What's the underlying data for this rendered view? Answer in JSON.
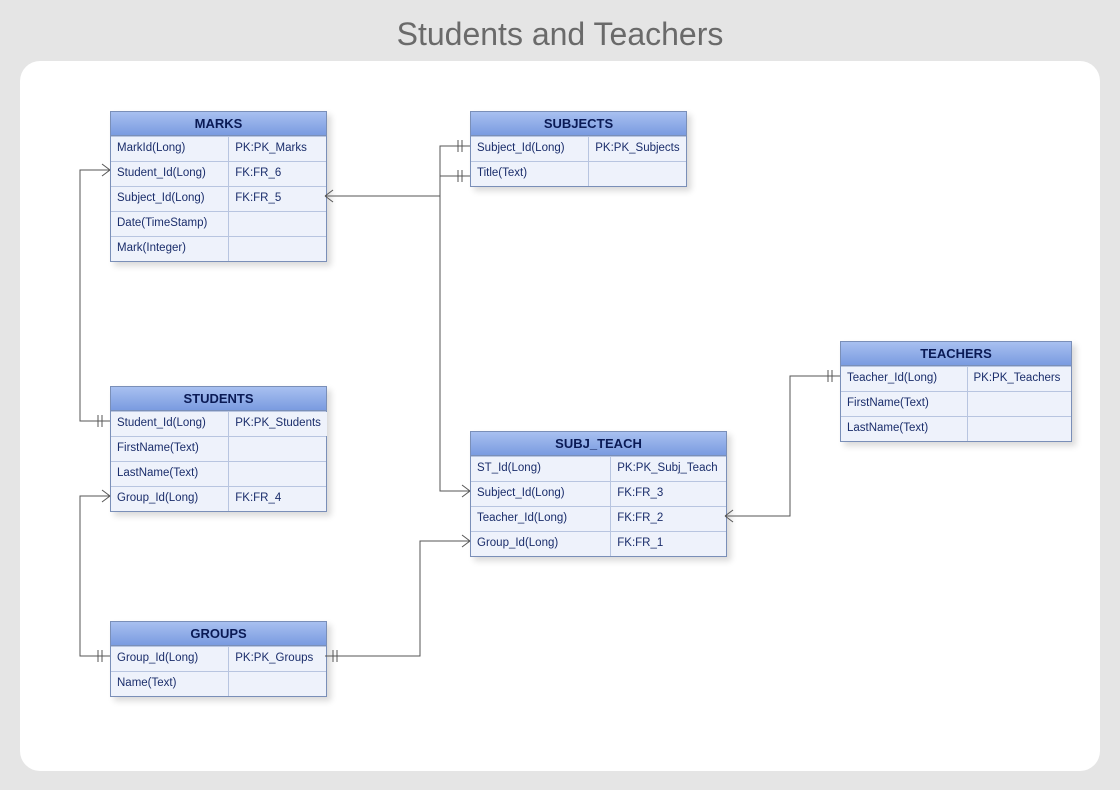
{
  "title": "Students and Teachers",
  "entities": {
    "marks": {
      "name": "MARKS",
      "rows": [
        {
          "col": "MarkId(Long)",
          "key": "PK:PK_Marks"
        },
        {
          "col": "Student_Id(Long)",
          "key": "FK:FR_6"
        },
        {
          "col": "Subject_Id(Long)",
          "key": "FK:FR_5"
        },
        {
          "col": "Date(TimeStamp)",
          "key": ""
        },
        {
          "col": "Mark(Integer)",
          "key": ""
        }
      ]
    },
    "subjects": {
      "name": "SUBJECTS",
      "rows": [
        {
          "col": "Subject_Id(Long)",
          "key": "PK:PK_Subjects"
        },
        {
          "col": "Title(Text)",
          "key": ""
        }
      ]
    },
    "students": {
      "name": "STUDENTS",
      "rows": [
        {
          "col": "Student_Id(Long)",
          "key": "PK:PK_Students"
        },
        {
          "col": "FirstName(Text)",
          "key": ""
        },
        {
          "col": "LastName(Text)",
          "key": ""
        },
        {
          "col": "Group_Id(Long)",
          "key": "FK:FR_4"
        }
      ]
    },
    "subj_teach": {
      "name": "SUBJ_TEACH",
      "rows": [
        {
          "col": "ST_Id(Long)",
          "key": "PK:PK_Subj_Teach"
        },
        {
          "col": "Subject_Id(Long)",
          "key": "FK:FR_3"
        },
        {
          "col": "Teacher_Id(Long)",
          "key": "FK:FR_2"
        },
        {
          "col": "Group_Id(Long)",
          "key": "FK:FR_1"
        }
      ]
    },
    "teachers": {
      "name": "TEACHERS",
      "rows": [
        {
          "col": "Teacher_Id(Long)",
          "key": "PK:PK_Teachers"
        },
        {
          "col": "FirstName(Text)",
          "key": ""
        },
        {
          "col": "LastName(Text)",
          "key": ""
        }
      ]
    },
    "groups": {
      "name": "GROUPS",
      "rows": [
        {
          "col": "Group_Id(Long)",
          "key": "PK:PK_Groups"
        },
        {
          "col": "Name(Text)",
          "key": ""
        }
      ]
    }
  }
}
